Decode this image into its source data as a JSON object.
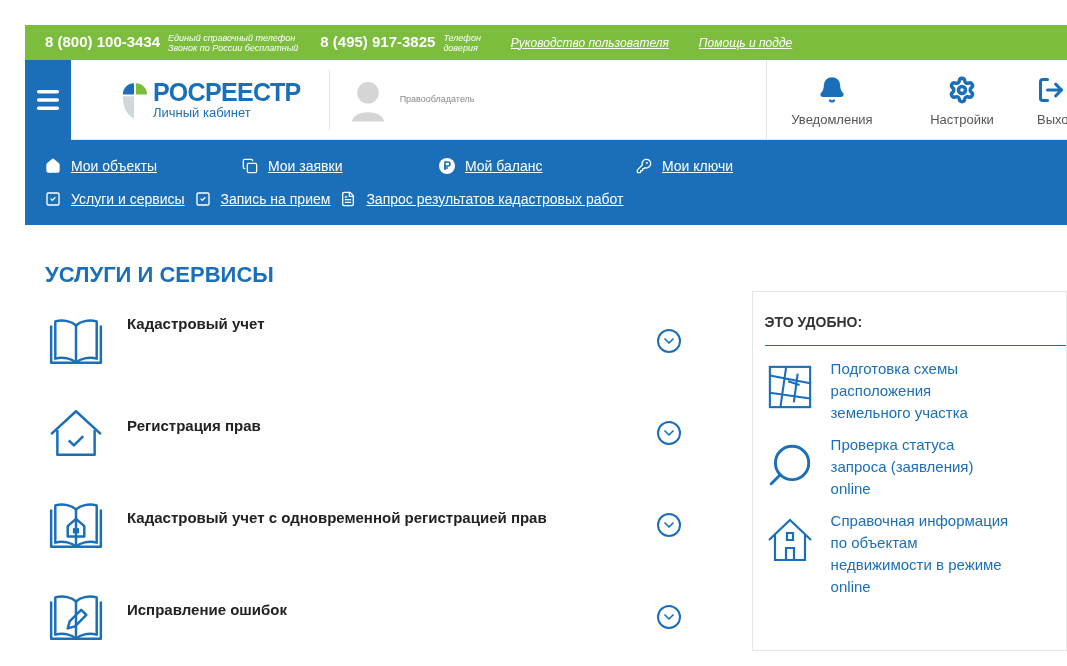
{
  "top_bar": {
    "phones": [
      {
        "number": "8 (800) 100-3434",
        "note_lines": [
          "Единый справочный телефон",
          "Звонок по России бесплатный"
        ]
      },
      {
        "number": "8 (495) 917-3825",
        "note_lines": [
          "Телефон",
          "доверия"
        ]
      }
    ],
    "links": [
      "Руководство пользователя",
      "Помощь и подде"
    ]
  },
  "header": {
    "logo": {
      "title": "РОСРЕЕСТР",
      "subtitle": "Личный кабинет"
    },
    "user_role": "Правообладатель",
    "actions": [
      {
        "kind": "bell",
        "label": "Уведомления"
      },
      {
        "kind": "gear",
        "label": "Настройки"
      },
      {
        "kind": "exit",
        "label": "Выхо"
      }
    ]
  },
  "nav": [
    [
      {
        "kind": "home",
        "label": "Мои объекты"
      },
      {
        "kind": "copy",
        "label": "Мои заявки"
      },
      {
        "kind": "coin",
        "label": "Мой баланс"
      },
      {
        "kind": "key",
        "label": "Мои ключи"
      }
    ],
    [
      {
        "kind": "check",
        "label": "Услуги и сервисы"
      },
      {
        "kind": "check",
        "label": "Запись на прием"
      },
      {
        "kind": "file",
        "label": "Запрос результатов кадастровых работ"
      }
    ]
  ],
  "page_title": "УСЛУГИ И СЕРВИСЫ",
  "services": [
    {
      "kind": "book",
      "title": "Кадастровый учет"
    },
    {
      "kind": "house-check",
      "title": "Регистрация прав"
    },
    {
      "kind": "book-house",
      "title": "Кадастровый учет с одновременной регистрацией прав"
    },
    {
      "kind": "book-pencil",
      "title": "Исправление ошибок"
    }
  ],
  "side_panel": {
    "title": "ЭТО УДОБНО:",
    "items": [
      {
        "kind": "map",
        "text": "Подготовка схемы расположения земельного участка"
      },
      {
        "kind": "search",
        "text": "Проверка статуса запроса (заявления) online"
      },
      {
        "kind": "house",
        "text": "Справочная информация по объектам недвижимости в режиме online"
      }
    ]
  }
}
